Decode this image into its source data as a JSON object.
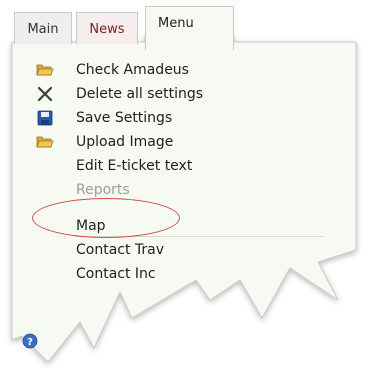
{
  "tabs": [
    {
      "label": "Main"
    },
    {
      "label": "News"
    },
    {
      "label": "Menu"
    }
  ],
  "menu": {
    "items": [
      {
        "label": "Check Amadeus",
        "icon": "folder-open-icon"
      },
      {
        "label": "Delete all settings",
        "icon": "close-x-icon"
      },
      {
        "label": "Save Settings",
        "icon": "floppy-disk-icon"
      },
      {
        "label": "Upload Image",
        "icon": "folder-open-icon"
      },
      {
        "label": "Edit E-ticket text",
        "icon": ""
      },
      {
        "label": "Reports",
        "icon": "",
        "state": "disabled"
      },
      {
        "label": "Map",
        "icon": ""
      },
      {
        "label": "Contact Trav",
        "icon": ""
      },
      {
        "label": "Contact Inc",
        "icon": ""
      }
    ],
    "help_icon": "help-icon"
  },
  "colors": {
    "panel_bg": "#f7faf3",
    "highlight_circle": "#d24a4a",
    "disabled_text": "#9c9c9c"
  }
}
